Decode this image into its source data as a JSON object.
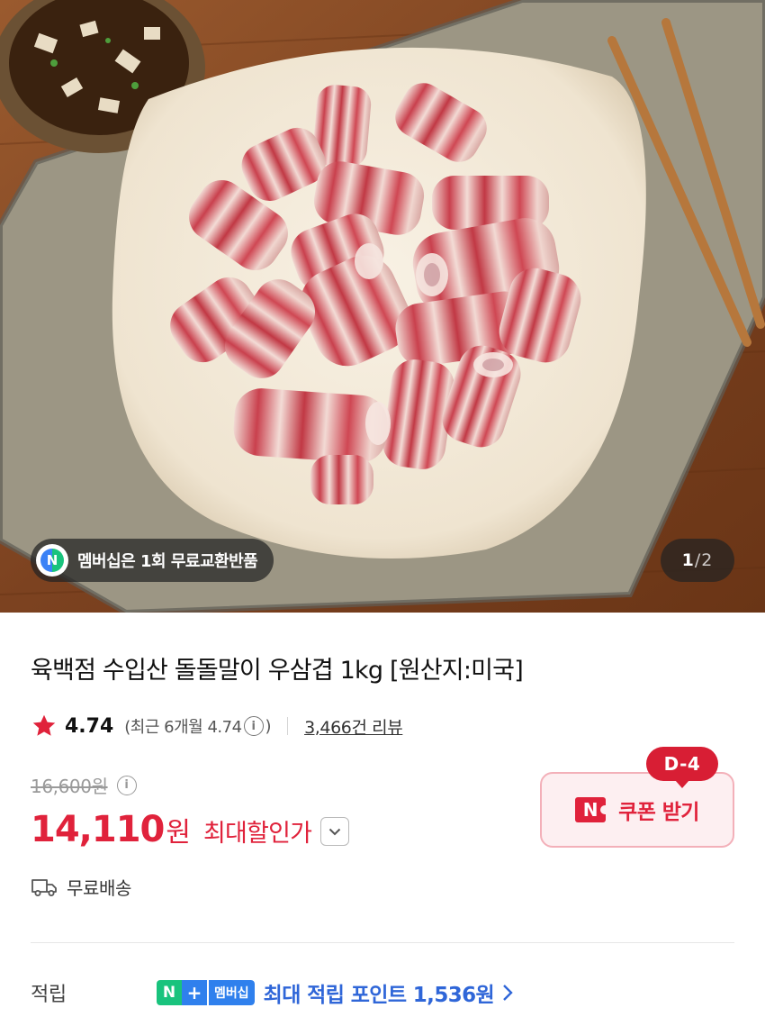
{
  "hero": {
    "image_description": "",
    "membership_pill": {
      "logo_letter": "N",
      "text": "멤버십은 1회 무료교환반품"
    },
    "counter": {
      "current": "1",
      "separator": "/",
      "total": "2"
    }
  },
  "product": {
    "title": "육백점 수입산 돌돌말이 우삼겹 1kg [원산지:미국]",
    "rating": {
      "score": "4.74",
      "recent_prefix": "(최근 6개월 4.74",
      "recent_suffix": ")",
      "review_count": "3,466건 리뷰"
    },
    "price": {
      "original": "16,600원",
      "sale": "14,110",
      "sale_unit": "원",
      "max_discount_label": "최대할인가"
    },
    "coupon": {
      "dday": "D-4",
      "icon_letter": "N",
      "label": "쿠폰 받기"
    },
    "shipping": {
      "label": "무료배송"
    },
    "points": {
      "label": "적립",
      "badge_n": "N",
      "badge_plus": "+",
      "badge_text": "멤버십",
      "text": "최대 적립 포인트 1,536원"
    }
  },
  "colors": {
    "accent_red": "#e0223b",
    "points_blue": "#2f66d8",
    "naver_green": "#19c37d"
  }
}
